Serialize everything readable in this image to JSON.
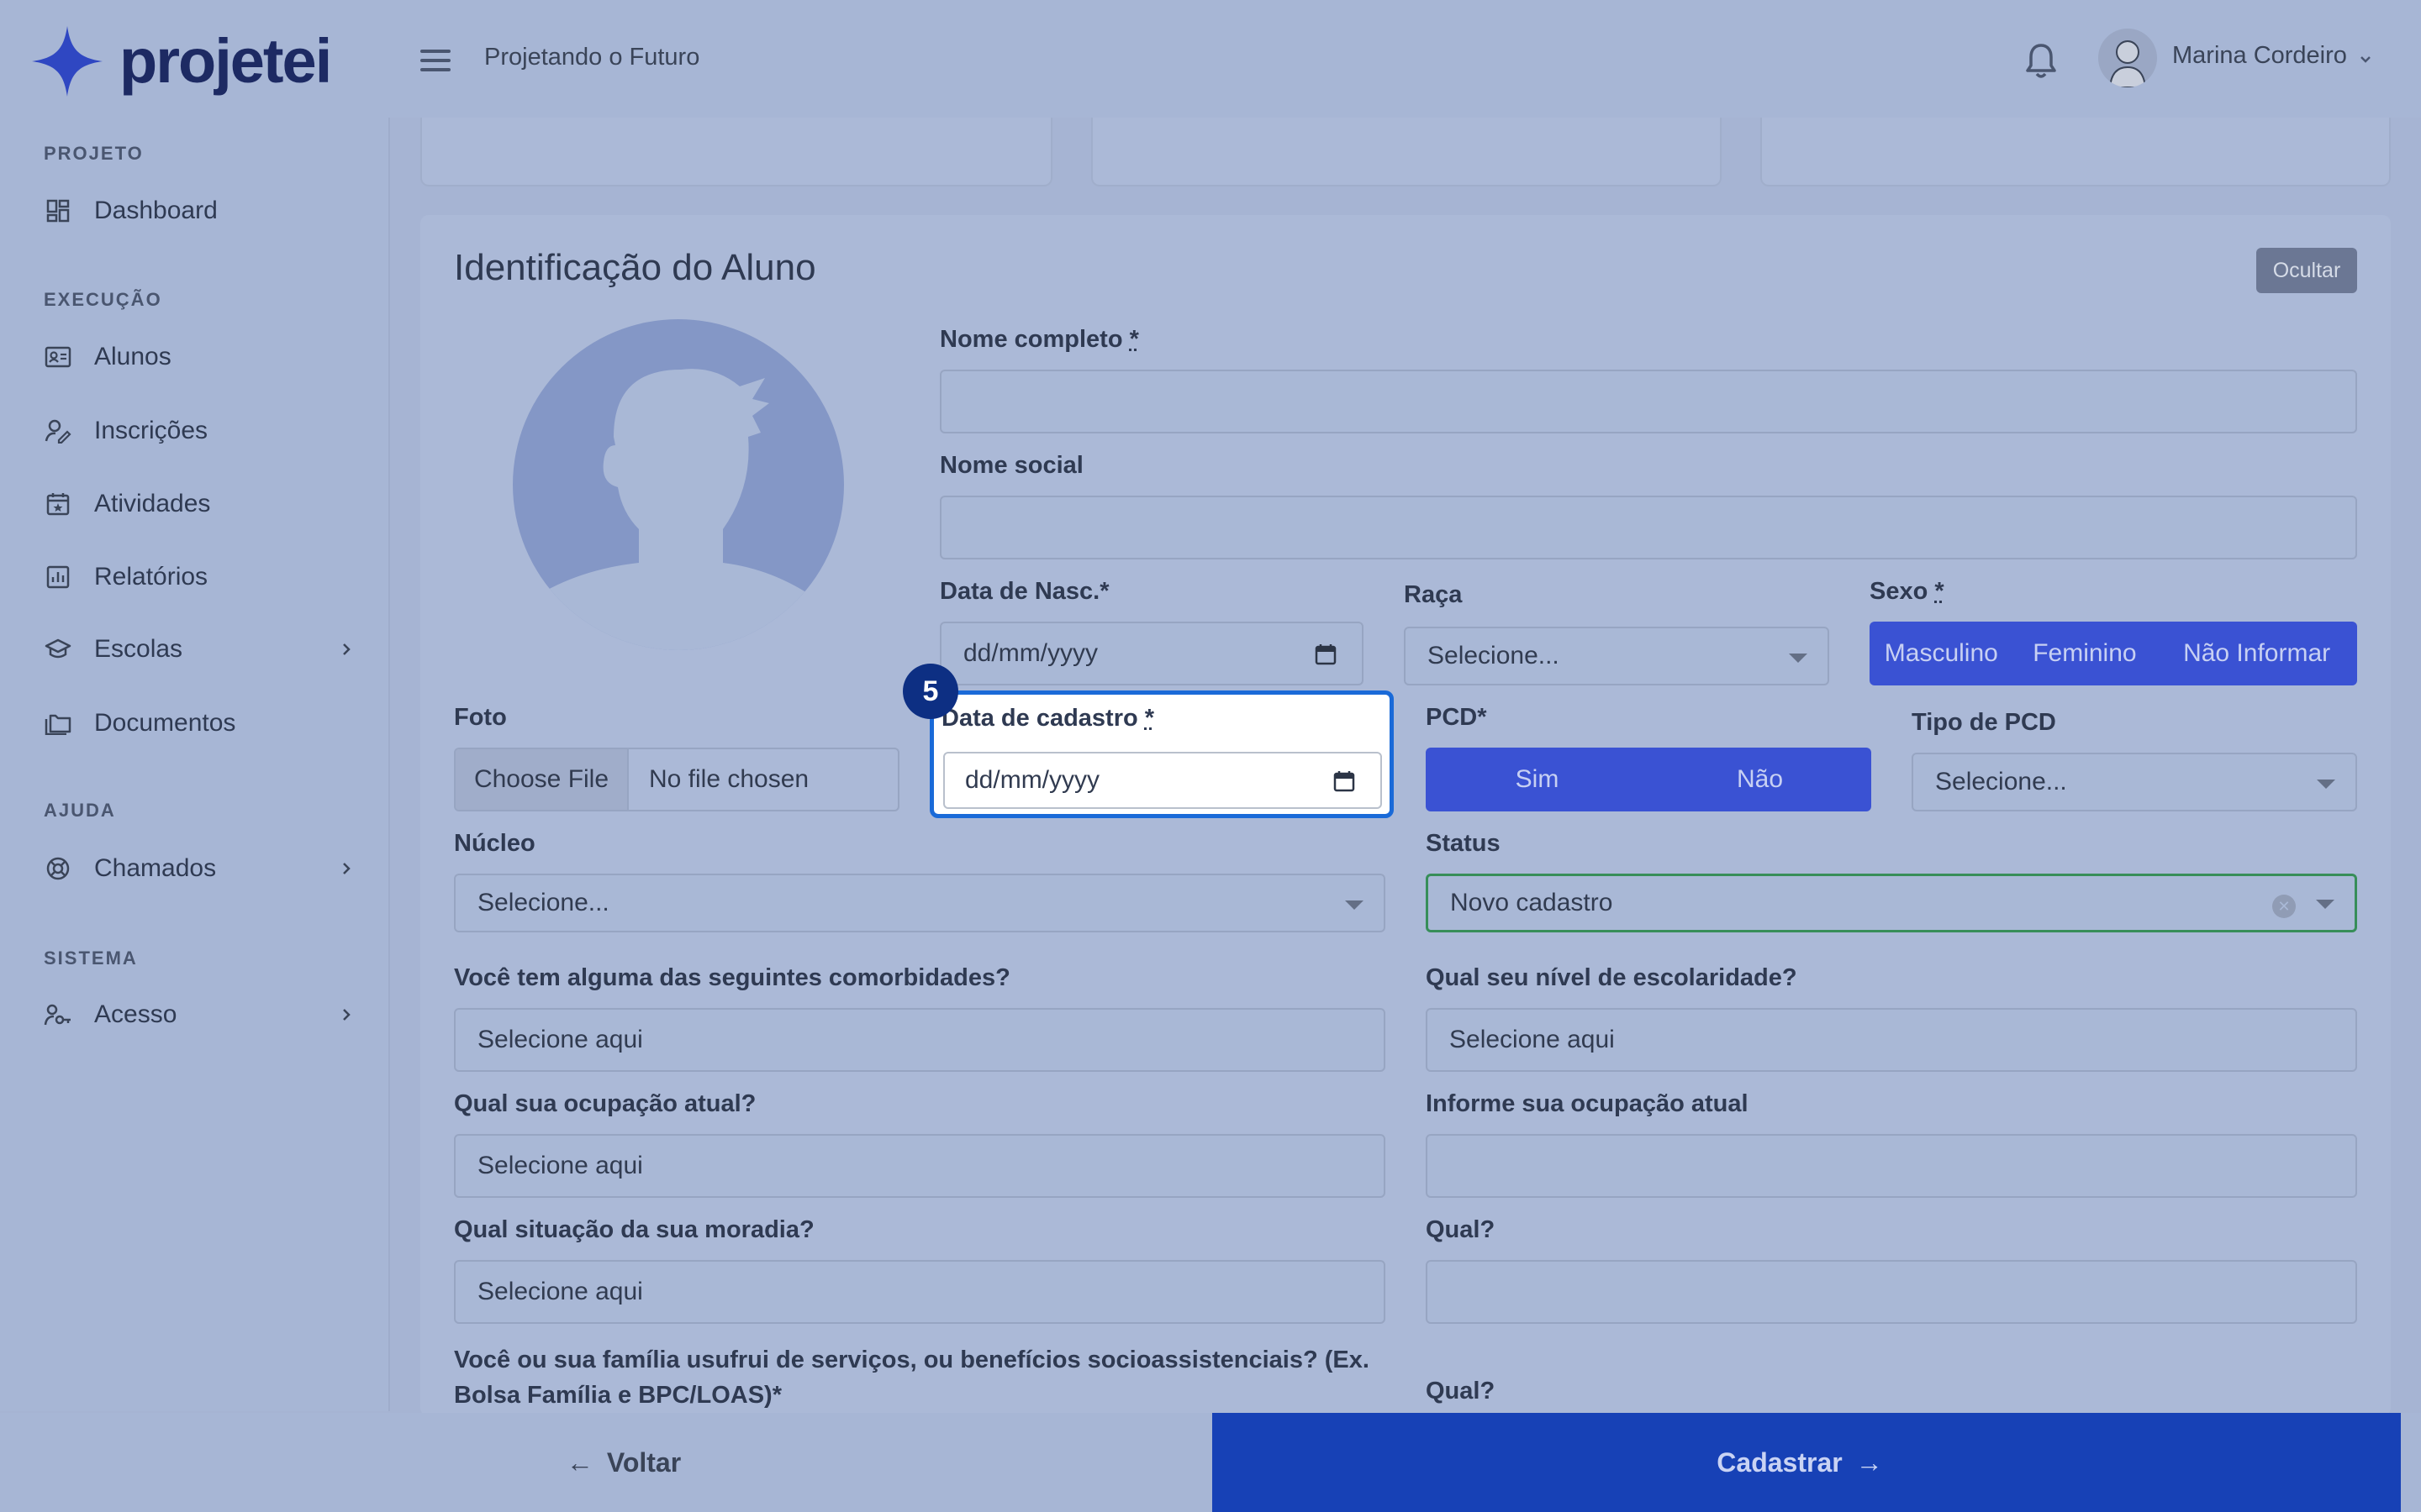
{
  "app": {
    "logo_text": "projetei",
    "project_name": "Projetando o Futuro",
    "user_name": "Marina Cordeiro"
  },
  "sidebar": {
    "sections": [
      {
        "label": "PROJETO",
        "items": [
          {
            "label": "Dashboard",
            "icon": "dashboard-icon"
          }
        ]
      },
      {
        "label": "EXECUÇÃO",
        "items": [
          {
            "label": "Alunos",
            "icon": "id-card-icon"
          },
          {
            "label": "Inscrições",
            "icon": "user-edit-icon"
          },
          {
            "label": "Atividades",
            "icon": "calendar-icon"
          },
          {
            "label": "Relatórios",
            "icon": "bar-chart-icon"
          },
          {
            "label": "Escolas",
            "icon": "graduation-cap-icon"
          },
          {
            "label": "Documentos",
            "icon": "folder-icon"
          }
        ]
      },
      {
        "label": "AJUDA",
        "items": [
          {
            "label": "Chamados",
            "icon": "lifebuoy-icon"
          }
        ]
      },
      {
        "label": "SISTEMA",
        "items": [
          {
            "label": "Acesso",
            "icon": "user-key-icon"
          }
        ]
      }
    ]
  },
  "form": {
    "title": "Identificação do Aluno",
    "hide_label": "Ocultar",
    "nome_completo": {
      "label": "Nome completo ",
      "req": "*",
      "value": ""
    },
    "nome_social": {
      "label": "Nome social",
      "value": ""
    },
    "data_nasc": {
      "label": "Data de Nasc.*",
      "placeholder": "dd/mm/yyyy"
    },
    "raca": {
      "label": "Raça",
      "value": "Selecione..."
    },
    "sexo": {
      "label": "Sexo ",
      "req": "*",
      "options": [
        "Masculino",
        "Feminino",
        "Não Informar"
      ]
    },
    "foto": {
      "label": "Foto",
      "button": "Choose File",
      "text": "No file chosen"
    },
    "data_cadastro": {
      "label": "Data de cadastro ",
      "req": "*",
      "placeholder": "dd/mm/yyyy",
      "step": "5"
    },
    "pcd": {
      "label": "PCD*",
      "options": [
        "Sim",
        "Não"
      ]
    },
    "tipo_pcd": {
      "label": "Tipo de PCD",
      "value": "Selecione..."
    },
    "nucleo": {
      "label": "Núcleo",
      "value": "Selecione..."
    },
    "status": {
      "label": "Status",
      "value": "Novo cadastro"
    },
    "comorbidades": {
      "label": "Você tem alguma das seguintes comorbidades?",
      "value": "Selecione aqui"
    },
    "escolaridade": {
      "label": "Qual seu nível de escolaridade?",
      "value": "Selecione aqui"
    },
    "ocupacao": {
      "label": "Qual sua ocupação atual?",
      "value": "Selecione aqui"
    },
    "informe_ocupacao": {
      "label": "Informe sua ocupação atual",
      "value": ""
    },
    "moradia": {
      "label": "Qual situação da sua moradia?",
      "value": "Selecione aqui"
    },
    "moradia_qual": {
      "label": "Qual?",
      "value": ""
    },
    "beneficios": {
      "label_line1": "Você ou sua família usufrui de serviços, ou benefícios socioassistenciais? (Ex.",
      "label_line2": "Bolsa Família e BPC/LOAS)*"
    },
    "beneficios_qual": {
      "label": "Qual?"
    }
  },
  "footer": {
    "back_label": "Voltar",
    "submit_label": "Cadastrar"
  },
  "colors": {
    "primary": "#1741b6",
    "segment": "#3a52d3",
    "focus": "#1a6ad8",
    "badge": "#0d2f83",
    "status_border": "#378e59"
  }
}
